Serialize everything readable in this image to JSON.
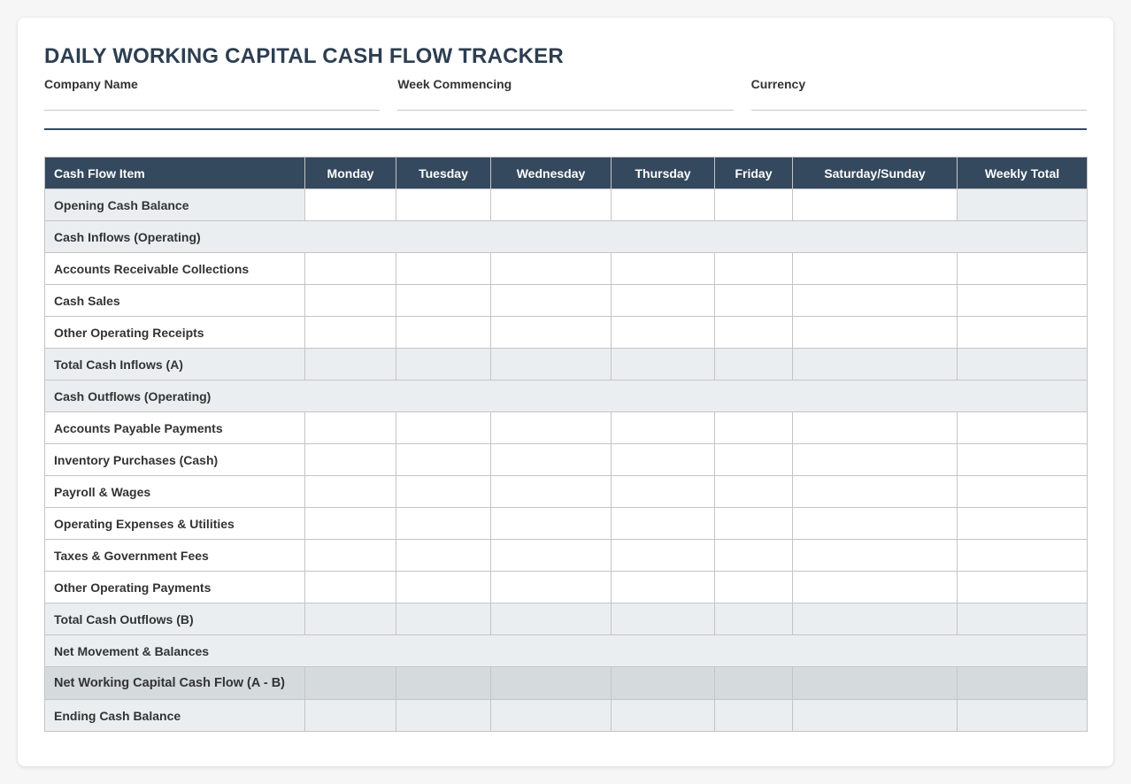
{
  "title": "DAILY WORKING CAPITAL CASH FLOW TRACKER",
  "fields": {
    "company": "Company Name",
    "week": "Week Commencing",
    "currency": "Currency"
  },
  "table": {
    "headers": [
      "Cash Flow Item",
      "Monday",
      "Tuesday",
      "Wednesday",
      "Thursday",
      "Friday",
      "Saturday/Sunday",
      "Weekly Total"
    ],
    "rows": {
      "opening": "Opening Cash Balance",
      "inflows_section": "Cash Inflows (Operating)",
      "ar_collections": "Accounts Receivable Collections",
      "cash_sales": "Cash Sales",
      "other_receipts": "Other Operating Receipts",
      "total_inflows": "Total Cash Inflows (A)",
      "outflows_section": "Cash Outflows (Operating)",
      "ap_payments": "Accounts Payable Payments",
      "inventory": "Inventory Purchases (Cash)",
      "payroll": "Payroll & Wages",
      "opex": "Operating Expenses & Utilities",
      "taxes": "Taxes & Government Fees",
      "other_payments": "Other Operating Payments",
      "total_outflows": "Total Cash Outflows (B)",
      "net_section": "Net Movement & Balances",
      "net_flow": "Net Working Capital Cash Flow (A - B)",
      "ending": "Ending Cash Balance"
    }
  }
}
